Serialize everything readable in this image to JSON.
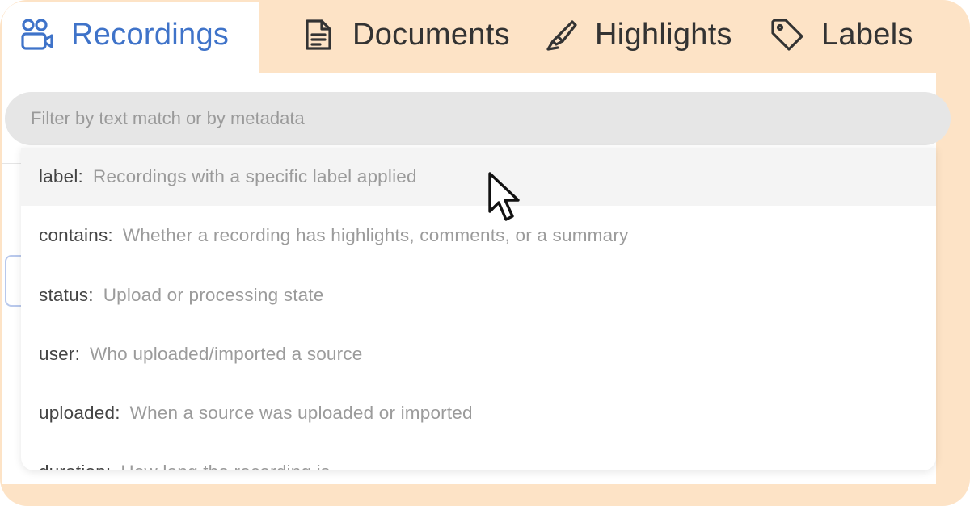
{
  "tabs": [
    {
      "label": "Recordings",
      "icon": "users-icon",
      "active": true
    },
    {
      "label": "Documents",
      "icon": "document-icon",
      "active": false
    },
    {
      "label": "Highlights",
      "icon": "highlighter-icon",
      "active": false
    },
    {
      "label": "Labels",
      "icon": "tag-icon",
      "active": false
    }
  ],
  "search": {
    "placeholder": "Filter by text match or by metadata",
    "value": ""
  },
  "filters": [
    {
      "key": "label:",
      "description": "Recordings with a specific label applied"
    },
    {
      "key": "contains:",
      "description": "Whether a recording has highlights, comments, or a summary"
    },
    {
      "key": "status:",
      "description": "Upload or processing state"
    },
    {
      "key": "user:",
      "description": "Who uploaded/imported a source"
    },
    {
      "key": "uploaded:",
      "description": "When a source was uploaded or imported"
    },
    {
      "key": "duration:",
      "description": "How long the recording is"
    }
  ],
  "colors": {
    "frame": "#fde3c6",
    "accent": "#3f73c9",
    "search_bg": "#e6e6e6"
  }
}
